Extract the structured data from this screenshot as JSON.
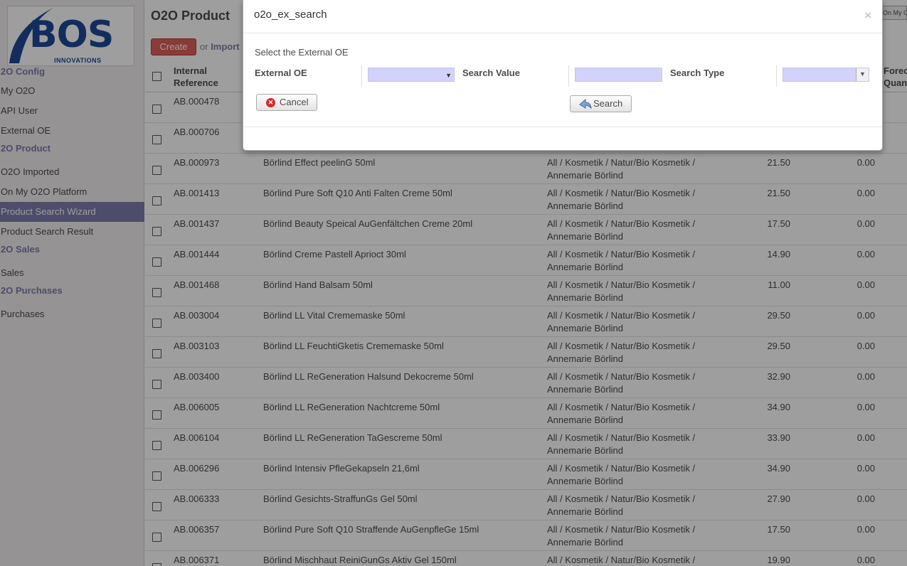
{
  "logo": {
    "brand": "BOS",
    "tagline": "INNOVATIONS"
  },
  "sidebar": {
    "sections": [
      {
        "title": "2O Config",
        "items": [
          "My O2O",
          "API User",
          "External OE"
        ]
      },
      {
        "title": "2O Product",
        "items": [
          "O2O Imported",
          "On My O2O Platform",
          "Product Search Wizard",
          "Product Search Result"
        ]
      },
      {
        "title": "2O Sales",
        "items": [
          "Sales"
        ]
      },
      {
        "title": "2O Purchases",
        "items": [
          "Purchases"
        ]
      }
    ],
    "active_item": "Product Search Wizard"
  },
  "main": {
    "title": "O2O Product",
    "create_label": "Create",
    "or_label": "or",
    "import_label": "Import",
    "top_right_button": "On My O"
  },
  "table": {
    "headers": {
      "ref": "Internal Reference",
      "forecast": "Forec Quan"
    },
    "rows": [
      {
        "ref": "AB.000478",
        "name": "",
        "category": "",
        "price": "",
        "qty": ""
      },
      {
        "ref": "AB.000706",
        "name": "",
        "category": "",
        "price": "",
        "qty": ""
      },
      {
        "ref": "AB.000973",
        "name": "Börlind Effect peelinG 50ml",
        "category": "All / Kosmetik / Natur/Bio Kosmetik / Annemarie Börlind",
        "price": "21.50",
        "qty": "0.00"
      },
      {
        "ref": "AB.001413",
        "name": "Börlind Pure Soft Q10 Anti Falten Creme 50ml",
        "category": "All / Kosmetik / Natur/Bio Kosmetik / Annemarie Börlind",
        "price": "21.50",
        "qty": "0.00"
      },
      {
        "ref": "AB.001437",
        "name": "Börlind Beauty Speical AuGenfältchen Creme 20ml",
        "category": "All / Kosmetik / Natur/Bio Kosmetik / Annemarie Börlind",
        "price": "17.50",
        "qty": "0.00"
      },
      {
        "ref": "AB.001444",
        "name": "Börlind Creme Pastell Aprioct 30ml",
        "category": "All / Kosmetik / Natur/Bio Kosmetik / Annemarie Börlind",
        "price": "14.90",
        "qty": "0.00"
      },
      {
        "ref": "AB.001468",
        "name": "Börlind Hand Balsam 50ml",
        "category": "All / Kosmetik / Natur/Bio Kosmetik / Annemarie Börlind",
        "price": "11.00",
        "qty": "0.00"
      },
      {
        "ref": "AB.003004",
        "name": "Börlind LL Vital Crememaske 50ml",
        "category": "All / Kosmetik / Natur/Bio Kosmetik / Annemarie Börlind",
        "price": "29.50",
        "qty": "0.00"
      },
      {
        "ref": "AB.003103",
        "name": "Börlind LL FeuchtiGketis Crememaske 50ml",
        "category": "All / Kosmetik / Natur/Bio Kosmetik / Annemarie Börlind",
        "price": "29.50",
        "qty": "0.00"
      },
      {
        "ref": "AB.003400",
        "name": "Börlind LL ReGeneration Halsund Dekocreme 50ml",
        "category": "All / Kosmetik / Natur/Bio Kosmetik / Annemarie Börlind",
        "price": "32.90",
        "qty": "0.00"
      },
      {
        "ref": "AB.006005",
        "name": "Börlind LL ReGeneration Nachtcreme 50ml",
        "category": "All / Kosmetik / Natur/Bio Kosmetik / Annemarie Börlind",
        "price": "34.90",
        "qty": "0.00"
      },
      {
        "ref": "AB.006104",
        "name": "Börlind LL ReGeneration TaGescreme 50ml",
        "category": "All / Kosmetik / Natur/Bio Kosmetik / Annemarie Börlind",
        "price": "33.90",
        "qty": "0.00"
      },
      {
        "ref": "AB.006296",
        "name": "Börlind Intensiv PfleGekapseln 21,6ml",
        "category": "All / Kosmetik / Natur/Bio Kosmetik / Annemarie Börlind",
        "price": "34.90",
        "qty": "0.00"
      },
      {
        "ref": "AB.006333",
        "name": "Börlind Gesichts-StraffunGs Gel 50ml",
        "category": "All / Kosmetik / Natur/Bio Kosmetik / Annemarie Börlind",
        "price": "27.90",
        "qty": "0.00"
      },
      {
        "ref": "AB.006357",
        "name": "Börlind Pure Soft Q10 Straffende AuGenpfleGe 15ml",
        "category": "All / Kosmetik / Natur/Bio Kosmetik / Annemarie Börlind",
        "price": "17.50",
        "qty": "0.00"
      },
      {
        "ref": "AB.006371",
        "name": "Börlind Mischhaut ReiniGunGs Aktiv Gel 150ml",
        "category": "All / Kosmetik / Natur/Bio Kosmetik / ",
        "price": "19.90",
        "qty": "0.00"
      }
    ]
  },
  "modal": {
    "title": "o2o_ex_search",
    "close": "×",
    "intro": "Select the External OE",
    "external_oe_label": "External OE",
    "external_oe_value": "",
    "search_value_label": "Search Value",
    "search_value": "",
    "search_type_label": "Search Type",
    "search_type_value": "",
    "cancel_label": "Cancel",
    "search_label": "Search"
  },
  "colors": {
    "accent": "#7c7bad",
    "create": "#dc5f59",
    "field_bg": "#d2d2fc",
    "logo_blue": "#1d4a96"
  }
}
